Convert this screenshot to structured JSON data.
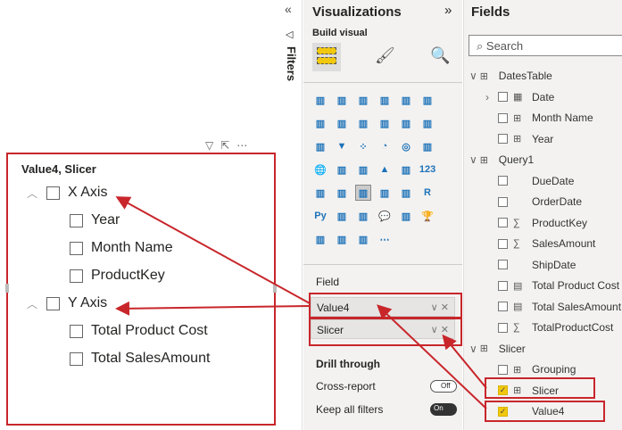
{
  "visual": {
    "title": "Value4, Slicer",
    "header_icons": [
      "filter-icon",
      "focus-mode-icon",
      "more-options-icon"
    ],
    "groups": [
      {
        "label": "X Axis",
        "items": [
          "Year",
          "Month Name",
          "ProductKey"
        ]
      },
      {
        "label": "Y Axis",
        "items": [
          "Total Product Cost",
          "Total SalesAmount"
        ]
      }
    ]
  },
  "filters": {
    "label": "Filters"
  },
  "visualizations": {
    "title": "Visualizations",
    "build_visual": "Build visual",
    "icons": [
      "stacked-bar",
      "stacked-column",
      "clustered-bar",
      "clustered-column",
      "100-bar",
      "100-column",
      "line",
      "area",
      "stacked-area",
      "line-column",
      "line-clustered",
      "ribbon",
      "waterfall",
      "funnel",
      "scatter",
      "pie",
      "donut",
      "treemap",
      "map",
      "filled-map",
      "shape-map",
      "azure-map",
      "gauge",
      "card",
      "multi-row-card",
      "kpi",
      "slicer",
      "table",
      "matrix",
      "r-visual",
      "python-visual",
      "key-influencers",
      "decomposition-tree",
      "qa",
      "smart-narrative",
      "goals",
      "paginated",
      "power-apps",
      "power-automate",
      "more"
    ],
    "field_label": "Field",
    "wells": [
      "Value4",
      "Slicer"
    ],
    "drill_through": "Drill through",
    "cross_report": "Cross-report",
    "cross_report_state": "Off",
    "keep_all_filters": "Keep all filters",
    "keep_all_filters_state": "On"
  },
  "fields": {
    "title": "Fields",
    "search_placeholder": "Search",
    "tables": [
      {
        "name": "DatesTable",
        "items": [
          {
            "name": "Date",
            "icon": "calendar",
            "checked": false
          },
          {
            "name": "Month Name",
            "icon": "calc-column",
            "checked": false
          },
          {
            "name": "Year",
            "icon": "calc-column",
            "checked": false
          }
        ]
      },
      {
        "name": "Query1",
        "items": [
          {
            "name": "DueDate",
            "icon": "",
            "checked": false
          },
          {
            "name": "OrderDate",
            "icon": "",
            "checked": false
          },
          {
            "name": "ProductKey",
            "icon": "sigma",
            "checked": false
          },
          {
            "name": "SalesAmount",
            "icon": "sigma",
            "checked": false
          },
          {
            "name": "ShipDate",
            "icon": "",
            "checked": false
          },
          {
            "name": "Total Product Cost",
            "icon": "measure",
            "checked": false
          },
          {
            "name": "Total SalesAmount",
            "icon": "measure",
            "checked": false
          },
          {
            "name": "TotalProductCost",
            "icon": "sigma",
            "checked": false
          }
        ]
      },
      {
        "name": "Slicer",
        "items": [
          {
            "name": "Grouping",
            "icon": "calc-column",
            "checked": false
          },
          {
            "name": "Slicer",
            "icon": "parameter",
            "checked": true
          },
          {
            "name": "Value4",
            "icon": "",
            "checked": true
          }
        ]
      }
    ]
  },
  "colors": {
    "accent": "#f2c80f",
    "annotation": "#c8262b"
  }
}
